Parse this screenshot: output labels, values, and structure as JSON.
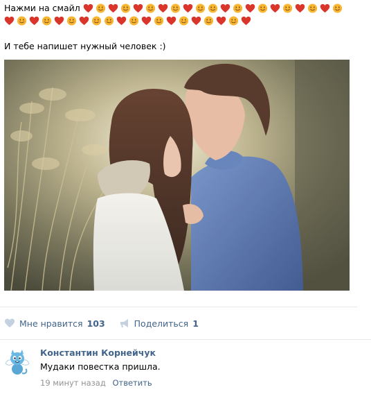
{
  "post": {
    "lead_text": "Нажми на смайл",
    "emoji_line1": [
      "heart",
      "smile",
      "heart",
      "smile",
      "heart",
      "smile",
      "heart",
      "smile",
      "heart",
      "smile",
      "smile",
      "heart",
      "smile",
      "heart",
      "smile",
      "heart",
      "smile",
      "heart",
      "smile",
      "heart",
      "smile"
    ],
    "emoji_line2": [
      "heart",
      "smile",
      "heart",
      "smile",
      "heart",
      "smile",
      "heart",
      "smile",
      "smile",
      "heart",
      "smile",
      "heart",
      "smile",
      "heart",
      "smile",
      "heart",
      "smile",
      "heart",
      "smile",
      "heart"
    ],
    "subtext": "И тебе напишет нужный человек :)",
    "photo_alt": "couple-photo"
  },
  "actions": {
    "like_label": "Мне нравится",
    "like_count": "103",
    "share_label": "Поделиться",
    "share_count": "1"
  },
  "comment": {
    "author": "Константин Корнейчук",
    "text": "Мудаки повестка пришла.",
    "time": "19 минут назад",
    "reply_label": "Ответить"
  },
  "colors": {
    "link": "#42648b",
    "muted": "#939393",
    "heart": "#d9352b",
    "smile": "#f7b731",
    "divider": "#e7e8ec"
  },
  "icons": {
    "like": "heart-icon",
    "share": "megaphone-icon",
    "avatar": "cat-mascot-avatar"
  }
}
